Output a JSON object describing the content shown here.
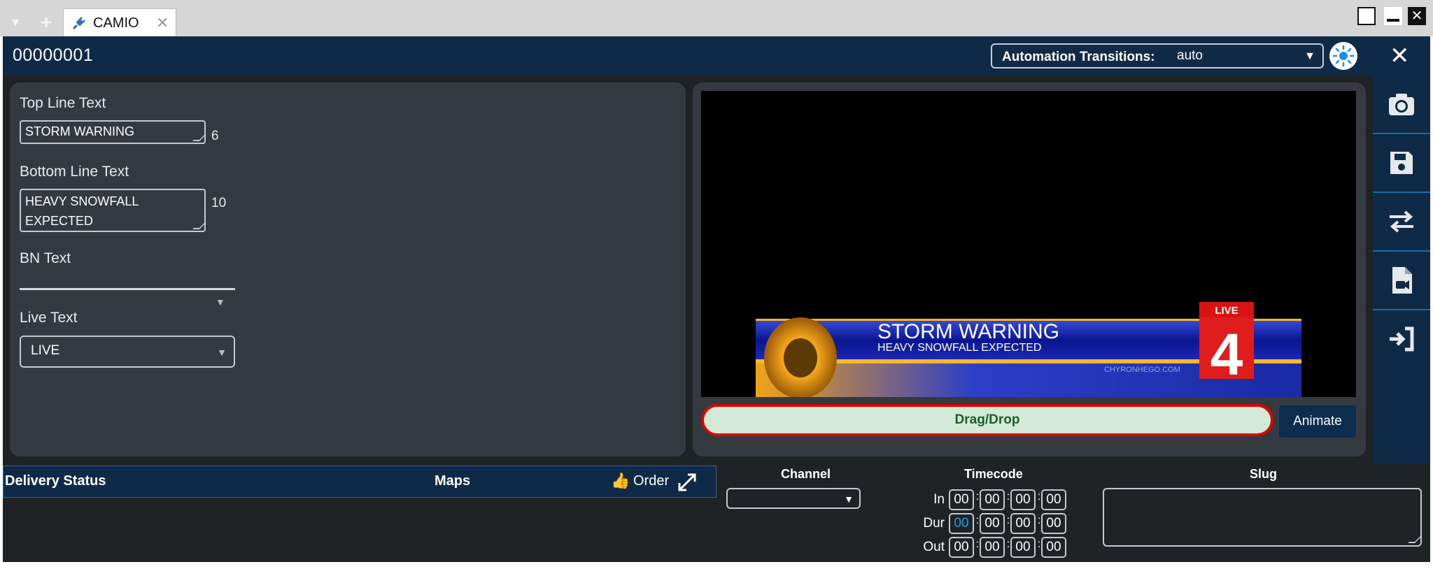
{
  "tabstrip": {
    "tab_title": "CAMIO",
    "tab_close": "✕",
    "menu_glyph": "▾",
    "new_glyph": "+"
  },
  "appbar": {
    "id": "00000001",
    "automation_label": "Automation Transitions:",
    "automation_value": "auto",
    "close_glyph": "✕"
  },
  "form": {
    "top_line_label": "Top Line Text",
    "top_line_value": "STORM WARNING",
    "top_line_count": "6",
    "bottom_line_label": "Bottom Line Text",
    "bottom_line_value": "HEAVY SNOWFALL EXPECTED",
    "bottom_line_count": "10",
    "bn_label": "BN Text",
    "live_label": "Live Text",
    "live_value": "LIVE"
  },
  "preview": {
    "headline": "STORM WARNING",
    "subline": "HEAVY SNOWFALL EXPECTED",
    "watermark": "CHYRONHEGO.COM",
    "live_badge": "LIVE",
    "channel_number": "4",
    "drag_drop_label": "Drag/Drop",
    "animate_label": "Animate"
  },
  "right_toolbar": {
    "items": [
      "camera-icon",
      "save-icon",
      "swap-icon",
      "video-file-icon",
      "sign-in-icon"
    ]
  },
  "bottom": {
    "delivery_status": "Delivery Status",
    "maps": "Maps",
    "order": "Order",
    "channel_header": "Channel",
    "timecode_header": "Timecode",
    "slug_header": "Slug",
    "in_label": "In",
    "dur_label": "Dur",
    "out_label": "Out",
    "tc_in": [
      "00",
      "00",
      "00",
      "00"
    ],
    "tc_dur": [
      "00",
      "00",
      "00",
      "00"
    ],
    "tc_out": [
      "00",
      "00",
      "00",
      "00"
    ]
  },
  "colors": {
    "appbar": "#0f2a47",
    "panel": "#343a3f",
    "drag_border": "#e00000",
    "drag_fill": "#d3ead8",
    "accent_blue": "#1aa0e8"
  }
}
